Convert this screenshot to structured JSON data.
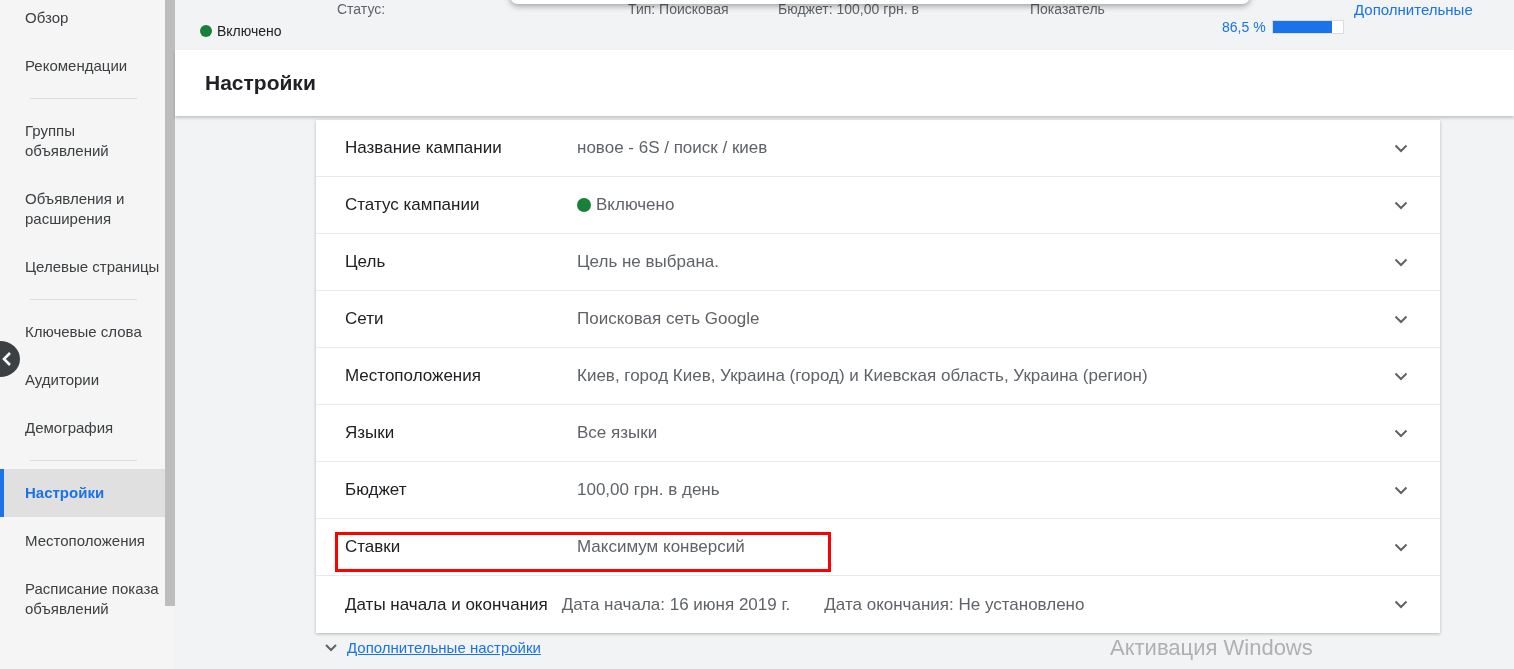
{
  "sidebar": {
    "sections": [
      {
        "items": [
          {
            "label": "Обзор",
            "selected": false
          },
          {
            "label": "Рекомендации",
            "selected": false
          }
        ]
      },
      {
        "items": [
          {
            "label": "Группы объявлений",
            "selected": false
          },
          {
            "label": "Объявления и расширения",
            "selected": false
          },
          {
            "label": "Целевые страницы",
            "selected": false
          }
        ]
      },
      {
        "items": [
          {
            "label": "Ключевые слова",
            "selected": false
          },
          {
            "label": "Аудитории",
            "selected": false
          },
          {
            "label": "Демография",
            "selected": false
          }
        ]
      },
      {
        "items": [
          {
            "label": "Настройки",
            "selected": true
          },
          {
            "label": "Местоположения",
            "selected": false
          },
          {
            "label": "Расписание показа объявлений",
            "selected": false
          }
        ]
      }
    ]
  },
  "summary": {
    "status_label": "Статус:",
    "status_value": "Включено",
    "status_enabled": true,
    "type": "Тип: Поисковая",
    "budget": "Бюджет: 100,00 грн. в",
    "score_label": "Показатель",
    "score_value": "86,5 %",
    "level": 0.85,
    "more_link": "Дополнительные"
  },
  "page_title": "Настройки",
  "settings": [
    {
      "label": "Название кампании",
      "values": [
        "новое - 6S / поиск / киев"
      ],
      "highlighted": false
    },
    {
      "label": "Статус кампании",
      "values": [
        "Включено"
      ],
      "status_enabled": true,
      "highlighted": false
    },
    {
      "label": "Цель",
      "values": [
        "Цель не выбрана."
      ],
      "highlighted": false
    },
    {
      "label": "Сети",
      "values": [
        "Поисковая сеть Google"
      ],
      "highlighted": false
    },
    {
      "label": "Местоположения",
      "values": [
        "Киев, город Киев, Украина (город) и Киевская область, Украина (регион)"
      ],
      "highlighted": false
    },
    {
      "label": "Языки",
      "values": [
        "Все языки"
      ],
      "highlighted": false
    },
    {
      "label": "Бюджет",
      "values": [
        "100,00 грн. в день"
      ],
      "highlighted": false
    },
    {
      "label": "Ставки",
      "values": [
        "Максимум конверсий"
      ],
      "highlighted": true
    },
    {
      "label": "Даты начала и окончания",
      "values": [
        "Дата начала: 16 июня 2019 г.",
        "Дата окончания: Не установлено"
      ],
      "highlighted": false
    }
  ],
  "more_settings_link": "Дополнительные настройки",
  "os_notice": "Активация Windows"
}
